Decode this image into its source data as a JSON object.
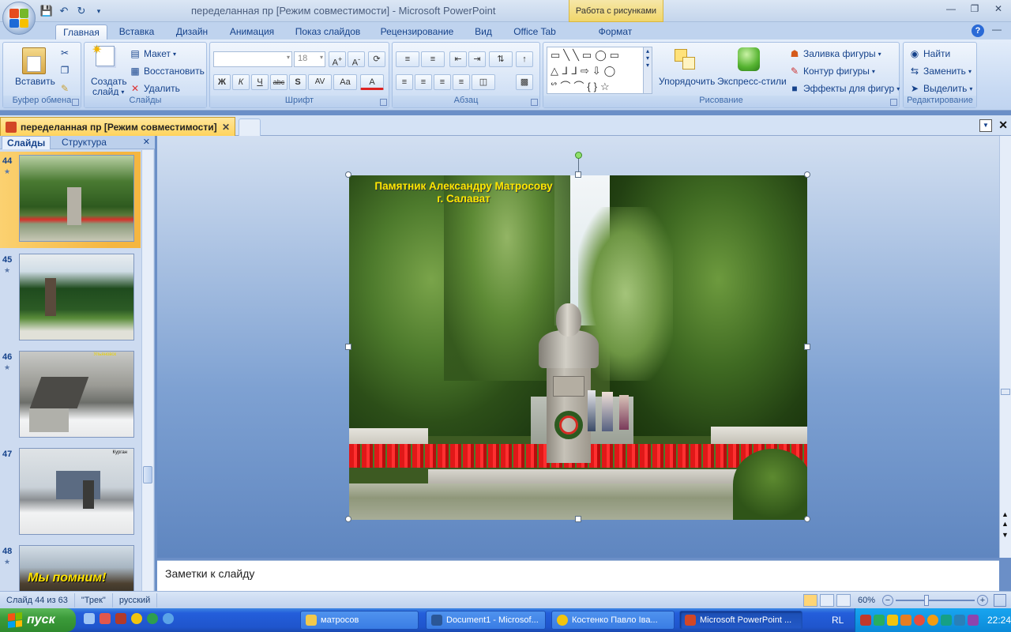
{
  "window": {
    "title": "переделанная пр [Режим совместимости] - Microsoft PowerPoint",
    "context_tab_title": "Работа с рисунками"
  },
  "tabs": [
    "Главная",
    "Вставка",
    "Дизайн",
    "Анимация",
    "Показ слайдов",
    "Рецензирование",
    "Вид",
    "Office Tab",
    "Формат"
  ],
  "ribbon": {
    "clipboard": {
      "label": "Буфер обмена",
      "paste": "Вставить"
    },
    "slides": {
      "label": "Слайды",
      "create": "Создать",
      "create2": "слайд",
      "layout": "Макет",
      "reset": "Восстановить",
      "delete": "Удалить"
    },
    "font": {
      "label": "Шрифт",
      "size": "18"
    },
    "paragraph": {
      "label": "Абзац"
    },
    "drawing": {
      "label": "Рисование",
      "arrange": "Упорядочить",
      "styles": "Экспресс-стили",
      "fill": "Заливка фигуры",
      "outline": "Контур фигуры",
      "effects": "Эффекты для фигур"
    },
    "editing": {
      "label": "Редактирование",
      "find": "Найти",
      "replace": "Заменить",
      "select": "Выделить"
    }
  },
  "document_tab": {
    "title": "переделанная пр [Режим совместимости]"
  },
  "pane": {
    "tabs": [
      "Слайды",
      "Структура"
    ],
    "thumbnails": [
      {
        "num": "44",
        "caption": "",
        "overlay": "",
        "selected": true
      },
      {
        "num": "45",
        "caption": "",
        "overlay": "",
        "selected": false
      },
      {
        "num": "46",
        "caption": "",
        "overlay": "Ульяновск",
        "selected": false
      },
      {
        "num": "47",
        "caption": "",
        "overlay": "Курган",
        "selected": false
      },
      {
        "num": "48",
        "caption": "",
        "overlay": "Мы помним!",
        "selected": false
      }
    ]
  },
  "slide": {
    "title_line1": "Памятник Александру Матросову",
    "title_line2": "г. Салават"
  },
  "notes": {
    "placeholder": "Заметки к слайду"
  },
  "status": {
    "slide_info": "Слайд 44 из 63",
    "theme": "\"Трек\"",
    "language": "русский",
    "zoom": "60%"
  },
  "taskbar": {
    "start": "пуск",
    "items": [
      "матросов",
      "Document1 - Microsof...",
      "Костенко Павло Іва...",
      "Microsoft PowerPoint ..."
    ],
    "lang": "RL",
    "time": "22:24"
  }
}
